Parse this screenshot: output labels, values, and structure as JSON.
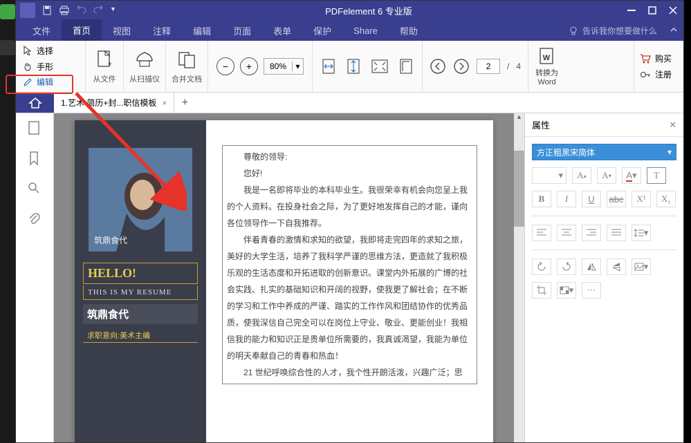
{
  "app": {
    "title": "PDFelement 6 专业版"
  },
  "menus": {
    "file": "文件",
    "home": "首页",
    "view": "视图",
    "comment": "注释",
    "edit": "编辑",
    "page": "页面",
    "form": "表单",
    "protect": "保护",
    "share": "Share",
    "help": "帮助",
    "tell_me": "告诉我你想要做什么"
  },
  "ribbon": {
    "select": "选择",
    "hand": "手形",
    "edit": "编辑",
    "from_file": "从文件",
    "from_scanner": "从扫描仪",
    "merge": "合并文档",
    "zoom_value": "80%",
    "page_current": "2",
    "page_sep": "/",
    "page_total": "4",
    "convert_line1": "转换为",
    "convert_line2": "Word",
    "buy": "购买",
    "register": "注册"
  },
  "tabs": {
    "doc1": "1.艺术  简历+封...职信模板",
    "close": "×",
    "add": "+"
  },
  "properties": {
    "title": "属性",
    "font_name": "方正粗黑宋简体",
    "bold": "B",
    "italic": "I",
    "underline": "U",
    "strike": "abc",
    "super": "X¹",
    "sub": "X₁"
  },
  "doc": {
    "photo_label": "筑鼎食代",
    "hello": "HELLO!",
    "subtitle": "THIS IS MY RESUME",
    "name": "筑鼎食代",
    "intent_label": "求职意向:",
    "intent_value": "美术主编",
    "greeting": "尊敬的领导:",
    "hello_cn": "您好!",
    "p1": "我是一名即将毕业的本科毕业生。我很荣幸有机会向您呈上我的个人资料。在投身社会之际，为了更好地发挥自己的才能，谨向各位领导作一下自我推荐。",
    "p2": "伴着青春的激情和求知的欲望，我即将走完四年的求知之旅，　美好的大学生活，培养了我科学严谨的思维方法，更造就了我积极乐观的生活态度和开拓进取的创新意识。课堂内外拓展的广博的社会实践、扎实的基础知识和开阔的视野，使我更了解社会；在不断的学习和工作中养成的严谨、踏实的工作作风和团结协作的优秀品质，使我深信自己完全可以在岗位上守业、敬业、更能创业！我相信我的能力和知识正是贵单位所需要的，我真诚渴望，我能为单位的明天奉献自己的青春和热血！",
    "p3": "21 世纪呼唤综合性的人才，我个性开朗活泼，兴趣广泛；思"
  }
}
